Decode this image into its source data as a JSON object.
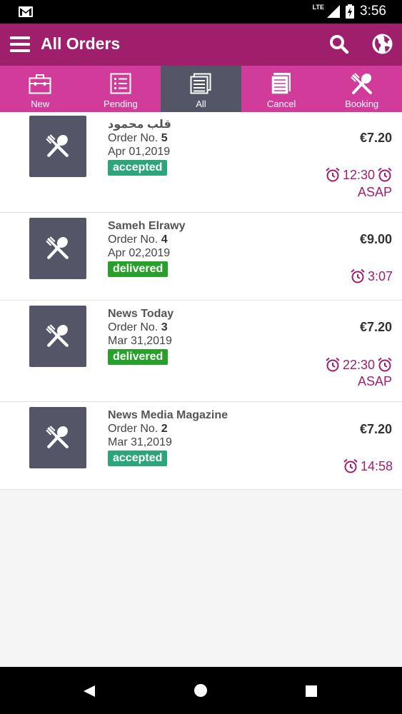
{
  "status_bar": {
    "network": "LTE",
    "time": "3:56"
  },
  "app_bar": {
    "title": "All Orders"
  },
  "tabs": [
    {
      "label": "New",
      "icon": "briefcase-icon"
    },
    {
      "label": "Pending",
      "icon": "checklist-icon"
    },
    {
      "label": "All",
      "icon": "document-list-icon",
      "active": true
    },
    {
      "label": "Cancel",
      "icon": "document-icon"
    },
    {
      "label": "Booking",
      "icon": "fork-spoon-icon"
    }
  ],
  "orders": [
    {
      "name": "قلب محمود",
      "order_label": "Order No.",
      "order_no": "5",
      "date": "Apr 01,2019",
      "status": "accepted",
      "price": "€7.20",
      "time": "12:30",
      "asap": "ASAP"
    },
    {
      "name": "Sameh Elrawy",
      "order_label": "Order No.",
      "order_no": "4",
      "date": "Apr 02,2019",
      "status": "delivered",
      "price": "€9.00",
      "time": "3:07",
      "asap": ""
    },
    {
      "name": "News Today",
      "order_label": "Order No.",
      "order_no": "3",
      "date": "Mar 31,2019",
      "status": "delivered",
      "price": "€7.20",
      "time": "22:30",
      "asap": "ASAP"
    },
    {
      "name": "News Media Magazine",
      "order_label": "Order No.",
      "order_no": "2",
      "date": "Mar 31,2019",
      "status": "accepted",
      "price": "€7.20",
      "time": "14:58",
      "asap": ""
    }
  ],
  "colors": {
    "primary": "#a01f6c",
    "tab_bar": "#d13c9b",
    "tab_active": "#545667",
    "accepted": "#2ca57a",
    "delivered": "#28a02c"
  }
}
